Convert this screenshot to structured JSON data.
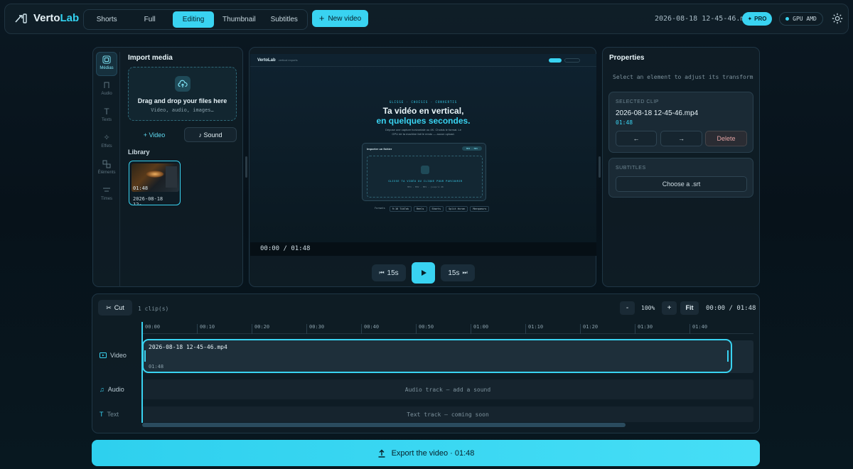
{
  "app": {
    "name_a": "Verto",
    "name_b": "Lab"
  },
  "header": {
    "tabs": [
      {
        "label": "Shorts",
        "active": false
      },
      {
        "label": "Full",
        "active": false
      },
      {
        "label": "Editing",
        "active": true
      },
      {
        "label": "Thumbnail",
        "active": false
      },
      {
        "label": "Subtitles",
        "active": false
      }
    ],
    "new_video": "New video",
    "filename": "2026-08-18 12-45-46.mp4",
    "pro_badge": "PRO",
    "gpu_badge": "GPU AMD"
  },
  "rail": {
    "items": [
      {
        "label": "Médias",
        "icon": "media-icon",
        "active": true
      },
      {
        "label": "Audio",
        "icon": "music-icon",
        "active": false
      },
      {
        "label": "Texts",
        "icon": "text-icon",
        "active": false
      },
      {
        "label": "Effets",
        "icon": "sparkle-icon",
        "active": false
      },
      {
        "label": "Éléments",
        "icon": "shapes-icon",
        "active": false
      },
      {
        "label": "Times",
        "icon": "times-icon",
        "active": false
      }
    ]
  },
  "media": {
    "title": "Import media",
    "drop_title": "Drag and drop your files here",
    "drop_sub": "Video, audio, images…",
    "add_video": "+ Video",
    "add_sound": "♪ Sound",
    "library": "Library",
    "clip": {
      "duration": "01:48",
      "name": "2026-08-18 12-..."
    }
  },
  "preview": {
    "inner": {
      "logo": "VertoLab",
      "tagline": "vertical exports",
      "kicker": "GLISSE · CHOISIS · CONVERTIS",
      "headline_1": "Ta vidéo en vertical,",
      "headline_2": "en quelques secondes.",
      "desc_1": "Dépose une capture horizontale ou 4K. Choisis le format. Le",
      "desc_2": "GPU de ta machine fait le rendu — aucun upload.",
      "card_title": "Importer un fichier",
      "card_badge": "MP4 · MOV",
      "drop_text": "GLISSE TA VIDÉO OU CLIQUE POUR PARCOURIR",
      "drop_sub": "MP4 · MOV · MKV · jusqu'à 4K",
      "chips": [
        "Formats",
        "9:16 TikTok",
        "Reels",
        "Shorts",
        "Split écran",
        "Marqueurs"
      ]
    },
    "timecode": "00:00 / 01:48",
    "back": "15s",
    "fwd": "15s"
  },
  "properties": {
    "title": "Properties",
    "hint": "Select an element to adjust its transform",
    "selected_label": "SELECTED CLIP",
    "clip_name": "2026-08-18 12-45-46.mp4",
    "clip_duration": "01:48",
    "prev": "←",
    "next": "→",
    "delete": "Delete",
    "subtitles_label": "SUBTITLES",
    "choose_srt": "Choose a .srt"
  },
  "timeline": {
    "cut": "Cut",
    "count": "1 clip(s)",
    "zoom_out": "-",
    "zoom": "100%",
    "zoom_in": "+",
    "fit": "Fit",
    "time": "00:00 / 01:48",
    "ticks": [
      "00:00",
      "00:10",
      "00:20",
      "00:30",
      "00:40",
      "00:50",
      "01:00",
      "01:10",
      "01:20",
      "01:30",
      "01:40"
    ],
    "tracks": {
      "video": "Video",
      "audio": "Audio",
      "text": "Text"
    },
    "clip_name": "2026-08-18 12-45-46.mp4",
    "clip_duration": "01:48",
    "audio_hint": "Audio track — add a sound",
    "text_hint": "Text track — coming soon"
  },
  "export": "Export the video · 01:48",
  "colors": {
    "accent": "#39d3f1",
    "bg": "#07121a",
    "delete": "#e0a1a1"
  }
}
